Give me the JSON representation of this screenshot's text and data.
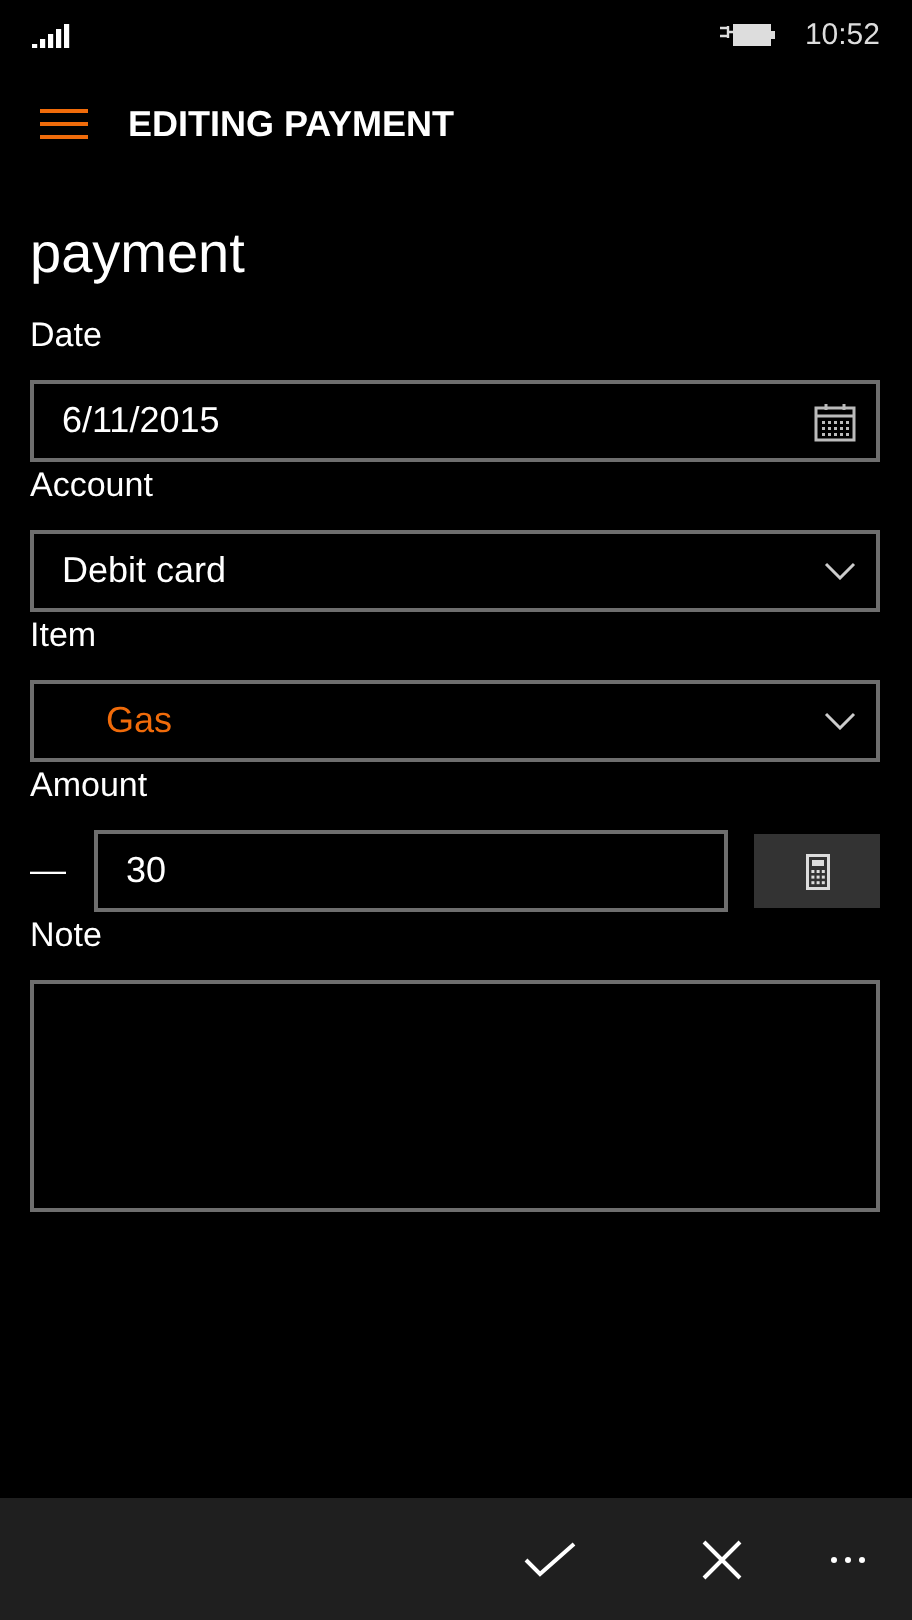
{
  "status_bar": {
    "time": "10:52"
  },
  "header": {
    "title": "EDITING PAYMENT"
  },
  "page_title": "payment",
  "fields": [
    {
      "kind": "date",
      "label": "Date",
      "value": "6/11/2015"
    },
    {
      "kind": "dropdown",
      "label": "Account",
      "value": "Debit card",
      "highlighted": false
    },
    {
      "kind": "dropdown",
      "label": "Item",
      "value": "Gas",
      "highlighted": true
    },
    {
      "kind": "amount",
      "label": "Amount",
      "sign": "—",
      "value": "30"
    },
    {
      "kind": "note",
      "label": "Note"
    }
  ],
  "app_bar": [
    {
      "kind": "accept"
    },
    {
      "kind": "cancel"
    },
    {
      "kind": "more"
    }
  ]
}
